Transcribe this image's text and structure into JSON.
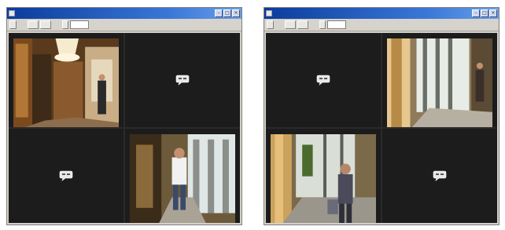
{
  "windows": [
    {
      "title": "",
      "toolbar": {
        "b1": "",
        "b2": "",
        "b3": "",
        "b4": "",
        "select": ""
      },
      "panes": [
        {
          "label": "",
          "camera": "lobby-lamp"
        },
        {
          "label": "",
          "camera": "none"
        },
        {
          "label": "",
          "camera": "none"
        },
        {
          "label": "",
          "camera": "corridor-walker"
        }
      ]
    },
    {
      "title": "",
      "toolbar": {
        "b1": "",
        "b2": "",
        "b3": "",
        "b4": "",
        "select": ""
      },
      "panes": [
        {
          "label": "",
          "camera": "none"
        },
        {
          "label": "",
          "camera": "hall-window"
        },
        {
          "label": "",
          "camera": "entrance-person"
        },
        {
          "label": "",
          "camera": "none"
        }
      ]
    }
  ],
  "colors": {
    "titlebar": "#0a3c9c",
    "chrome": "#d4d0c8",
    "pane_bg": "#1c1c1c",
    "label_text": "#8a8a8a"
  },
  "icons": {
    "no_signal": "speech-bubble-icon",
    "window_controls": [
      "minimize-icon",
      "maximize-icon",
      "close-icon"
    ]
  }
}
